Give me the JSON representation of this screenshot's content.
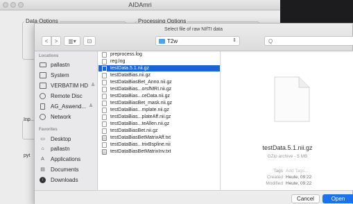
{
  "app": {
    "title": "AIDAmri"
  },
  "background": {
    "data_options_label": "Data Options",
    "processing_options_label": "Processing Options",
    "input_label": "Inp",
    "python_label": "pyt"
  },
  "dialog": {
    "title": "Select file of raw NIfTI data",
    "location": "T2w",
    "search_placeholder": "Q",
    "nav": {
      "back": "<",
      "forward": ">",
      "view": "▥▾",
      "new_folder": "⊡"
    }
  },
  "sidebar": {
    "locations_header": "Locations",
    "favorites_header": "Favorites",
    "locations": [
      {
        "label": "pallastn",
        "icon": "laptop-icon",
        "eject": ""
      },
      {
        "label": "System",
        "icon": "hard-drive-icon",
        "eject": ""
      },
      {
        "label": "VERBATIM HD",
        "icon": "external-drive-icon",
        "eject": "≜"
      },
      {
        "label": "Remote Disc",
        "icon": "disc-icon",
        "eject": ""
      },
      {
        "label": "AG_Aswend...",
        "icon": "removable-drive-icon",
        "eject": "≜"
      },
      {
        "label": "Network",
        "icon": "globe-icon",
        "eject": ""
      }
    ],
    "favorites": [
      {
        "label": "Desktop",
        "icon": "desktop-icon",
        "glyph": "▭"
      },
      {
        "label": "pallastn",
        "icon": "home-icon",
        "glyph": "⌂"
      },
      {
        "label": "Applications",
        "icon": "applications-icon",
        "glyph": "A"
      },
      {
        "label": "Documents",
        "icon": "documents-icon",
        "glyph": "▤"
      },
      {
        "label": "Downloads",
        "icon": "downloads-icon",
        "glyph": "↓"
      }
    ]
  },
  "files": [
    {
      "name": "preprocess.log",
      "type": "doc",
      "selected": false
    },
    {
      "name": "reg.log",
      "type": "doc",
      "selected": false
    },
    {
      "name": "testData.5.1.nii.gz",
      "type": "doc",
      "selected": true
    },
    {
      "name": "testDataBias.nii.gz",
      "type": "doc",
      "selected": false
    },
    {
      "name": "testDataBiasBet_Anno.nii.gz",
      "type": "doc",
      "selected": false
    },
    {
      "name": "testDataBias...orsfMRI.nii.gz",
      "type": "doc",
      "selected": false
    },
    {
      "name": "testDataBias...ceData.nii.gz",
      "type": "doc",
      "selected": false
    },
    {
      "name": "testDataBiasBet_mask.nii.gz",
      "type": "doc",
      "selected": false
    },
    {
      "name": "testDataBias...mplate.nii.gz",
      "type": "doc",
      "selected": false
    },
    {
      "name": "testDataBias...plateAff.nii.gz",
      "type": "doc",
      "selected": false
    },
    {
      "name": "testDataBias...teAllen.nii.gz",
      "type": "doc",
      "selected": false
    },
    {
      "name": "testDataBiasBet.nii.gz",
      "type": "doc",
      "selected": false
    },
    {
      "name": "testDataBiasBetMatrixAff.txt",
      "type": "txt",
      "selected": false
    },
    {
      "name": "testDataBias...trixBspline.nii",
      "type": "doc",
      "selected": false
    },
    {
      "name": "testDataBiasBetMatrixInv.txt",
      "type": "txt",
      "selected": false
    }
  ],
  "preview": {
    "filename": "testData.5.1.nii.gz",
    "kind": "GZip archive - 5 MB",
    "tags_label": "Tags",
    "tags_value": "Add Tags...",
    "created_label": "Created",
    "created_value": "Heute, 09:22",
    "modified_label": "Modified",
    "modified_value": "Heute, 09:22"
  },
  "footer": {
    "cancel": "Cancel",
    "open": "Open"
  },
  "colors": {
    "selection": "#1a64d6",
    "primary_button": "#1a72ef",
    "folder": "#4aa3f0"
  }
}
